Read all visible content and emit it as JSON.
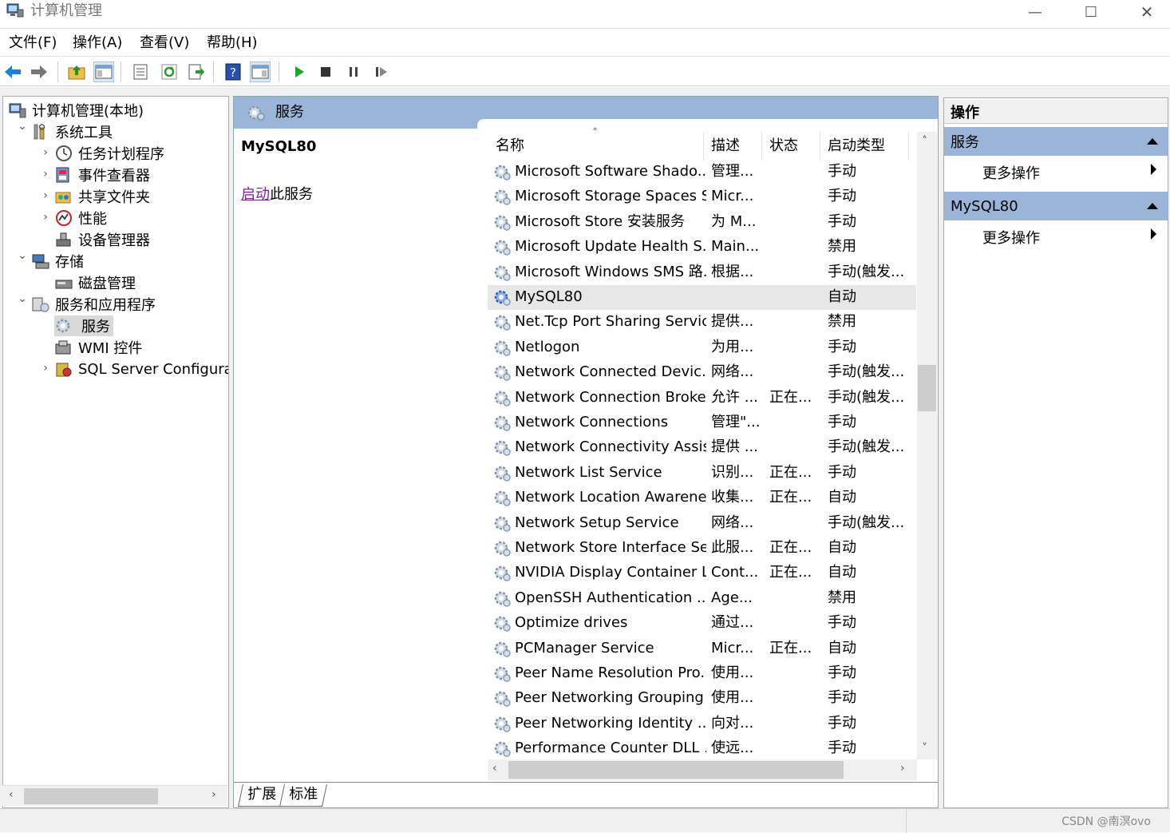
{
  "window": {
    "title": "计算机管理",
    "min": "—",
    "max": "☐",
    "close": "✕"
  },
  "menu": [
    "文件(F)",
    "操作(A)",
    "查看(V)",
    "帮助(H)"
  ],
  "tree": [
    {
      "label": "计算机管理(本地)",
      "icon": "computer-icon",
      "level": 0,
      "chevron": ""
    },
    {
      "label": "系统工具",
      "icon": "tools-icon",
      "level": 1,
      "chevron": "⌄"
    },
    {
      "label": "任务计划程序",
      "icon": "clock-icon",
      "level": 2,
      "chevron": "›"
    },
    {
      "label": "事件查看器",
      "icon": "event-viewer-icon",
      "level": 2,
      "chevron": "›"
    },
    {
      "label": "共享文件夹",
      "icon": "shared-folder-icon",
      "level": 2,
      "chevron": "›"
    },
    {
      "label": "性能",
      "icon": "performance-icon",
      "level": 2,
      "chevron": "›"
    },
    {
      "label": "设备管理器",
      "icon": "device-manager-icon",
      "level": 2,
      "chevron": ""
    },
    {
      "label": "存储",
      "icon": "storage-icon",
      "level": 1,
      "chevron": "⌄"
    },
    {
      "label": "磁盘管理",
      "icon": "disk-icon",
      "level": 2,
      "chevron": ""
    },
    {
      "label": "服务和应用程序",
      "icon": "services-apps-icon",
      "level": 1,
      "chevron": "⌄"
    },
    {
      "label": "服务",
      "icon": "gear-icon",
      "level": 2,
      "chevron": "",
      "selected": true
    },
    {
      "label": "WMI 控件",
      "icon": "wmi-icon",
      "level": 2,
      "chevron": ""
    },
    {
      "label": "SQL Server Configurati",
      "icon": "sql-server-icon",
      "level": 2,
      "chevron": "›"
    }
  ],
  "services_panel": {
    "header": "服务",
    "selected_name": "MySQL80",
    "link_text": "启动",
    "link_suffix": "此服务",
    "columns": [
      "名称",
      "描述",
      "状态",
      "启动类型"
    ],
    "sort_indicator": "˄",
    "rows": [
      [
        "Microsoft Software Shado...",
        "管理...",
        "",
        "手动"
      ],
      [
        "Microsoft Storage Spaces S...",
        "Micr...",
        "",
        "手动"
      ],
      [
        "Microsoft Store 安装服务",
        "为 M...",
        "",
        "手动"
      ],
      [
        "Microsoft Update Health S...",
        "Main...",
        "",
        "禁用"
      ],
      [
        "Microsoft Windows SMS 路...",
        "根据...",
        "",
        "手动(触发..."
      ],
      [
        "MySQL80",
        "",
        "",
        "自动"
      ],
      [
        "Net.Tcp Port Sharing Service",
        "提供...",
        "",
        "禁用"
      ],
      [
        "Netlogon",
        "为用...",
        "",
        "手动"
      ],
      [
        "Network Connected Devic...",
        "网络...",
        "",
        "手动(触发..."
      ],
      [
        "Network Connection Broker",
        "允许 ...",
        "正在...",
        "手动(触发..."
      ],
      [
        "Network Connections",
        "管理\"...",
        "",
        "手动"
      ],
      [
        "Network Connectivity Assis...",
        "提供 ...",
        "",
        "手动(触发..."
      ],
      [
        "Network List Service",
        "识别...",
        "正在...",
        "手动"
      ],
      [
        "Network Location Awarene...",
        "收集...",
        "正在...",
        "自动"
      ],
      [
        "Network Setup Service",
        "网络...",
        "",
        "手动(触发..."
      ],
      [
        "Network Store Interface Se...",
        "此服...",
        "正在...",
        "自动"
      ],
      [
        "NVIDIA Display Container LS",
        "Cont...",
        "正在...",
        "自动"
      ],
      [
        "OpenSSH Authentication ...",
        "Age...",
        "",
        "禁用"
      ],
      [
        "Optimize drives",
        "通过...",
        "",
        "手动"
      ],
      [
        "PCManager Service",
        "Micr...",
        "正在...",
        "自动"
      ],
      [
        "Peer Name Resolution Pro...",
        "使用...",
        "",
        "手动"
      ],
      [
        "Peer Networking Grouping",
        "使用...",
        "",
        "手动"
      ],
      [
        "Peer Networking Identity ...",
        "向对...",
        "",
        "手动"
      ],
      [
        "Performance Counter DLL ...",
        "使远...",
        "",
        "手动"
      ]
    ],
    "selected_row": 5,
    "tabs": [
      "扩展",
      "标准"
    ]
  },
  "actions": {
    "title": "操作",
    "sections": [
      {
        "header": "服务",
        "item": "更多操作"
      },
      {
        "header": "MySQL80",
        "item": "更多操作"
      }
    ]
  },
  "status": {
    "watermark": "CSDN @南溟ovo"
  },
  "colors": {
    "accent_header": "#9bb5d8",
    "link": "#7b1fa2",
    "selection": "#e7e7e7"
  }
}
